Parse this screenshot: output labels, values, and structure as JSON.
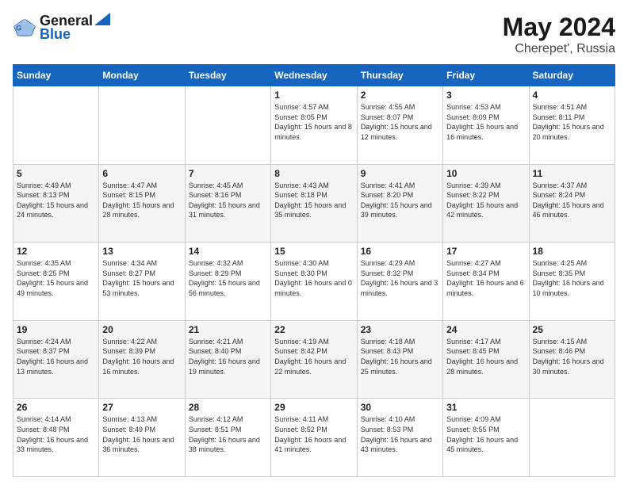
{
  "header": {
    "logo_line1": "General",
    "logo_line2": "Blue",
    "month_year": "May 2024",
    "location": "Cherepet', Russia"
  },
  "days_of_week": [
    "Sunday",
    "Monday",
    "Tuesday",
    "Wednesday",
    "Thursday",
    "Friday",
    "Saturday"
  ],
  "weeks": [
    [
      {
        "day": "",
        "info": ""
      },
      {
        "day": "",
        "info": ""
      },
      {
        "day": "",
        "info": ""
      },
      {
        "day": "1",
        "info": "Sunrise: 4:57 AM\nSunset: 8:05 PM\nDaylight: 15 hours\nand 8 minutes."
      },
      {
        "day": "2",
        "info": "Sunrise: 4:55 AM\nSunset: 8:07 PM\nDaylight: 15 hours\nand 12 minutes."
      },
      {
        "day": "3",
        "info": "Sunrise: 4:53 AM\nSunset: 8:09 PM\nDaylight: 15 hours\nand 16 minutes."
      },
      {
        "day": "4",
        "info": "Sunrise: 4:51 AM\nSunset: 8:11 PM\nDaylight: 15 hours\nand 20 minutes."
      }
    ],
    [
      {
        "day": "5",
        "info": "Sunrise: 4:49 AM\nSunset: 8:13 PM\nDaylight: 15 hours\nand 24 minutes."
      },
      {
        "day": "6",
        "info": "Sunrise: 4:47 AM\nSunset: 8:15 PM\nDaylight: 15 hours\nand 28 minutes."
      },
      {
        "day": "7",
        "info": "Sunrise: 4:45 AM\nSunset: 8:16 PM\nDaylight: 15 hours\nand 31 minutes."
      },
      {
        "day": "8",
        "info": "Sunrise: 4:43 AM\nSunset: 8:18 PM\nDaylight: 15 hours\nand 35 minutes."
      },
      {
        "day": "9",
        "info": "Sunrise: 4:41 AM\nSunset: 8:20 PM\nDaylight: 15 hours\nand 39 minutes."
      },
      {
        "day": "10",
        "info": "Sunrise: 4:39 AM\nSunset: 8:22 PM\nDaylight: 15 hours\nand 42 minutes."
      },
      {
        "day": "11",
        "info": "Sunrise: 4:37 AM\nSunset: 8:24 PM\nDaylight: 15 hours\nand 46 minutes."
      }
    ],
    [
      {
        "day": "12",
        "info": "Sunrise: 4:35 AM\nSunset: 8:25 PM\nDaylight: 15 hours\nand 49 minutes."
      },
      {
        "day": "13",
        "info": "Sunrise: 4:34 AM\nSunset: 8:27 PM\nDaylight: 15 hours\nand 53 minutes."
      },
      {
        "day": "14",
        "info": "Sunrise: 4:32 AM\nSunset: 8:29 PM\nDaylight: 15 hours\nand 56 minutes."
      },
      {
        "day": "15",
        "info": "Sunrise: 4:30 AM\nSunset: 8:30 PM\nDaylight: 16 hours\nand 0 minutes."
      },
      {
        "day": "16",
        "info": "Sunrise: 4:29 AM\nSunset: 8:32 PM\nDaylight: 16 hours\nand 3 minutes."
      },
      {
        "day": "17",
        "info": "Sunrise: 4:27 AM\nSunset: 8:34 PM\nDaylight: 16 hours\nand 6 minutes."
      },
      {
        "day": "18",
        "info": "Sunrise: 4:25 AM\nSunset: 8:35 PM\nDaylight: 16 hours\nand 10 minutes."
      }
    ],
    [
      {
        "day": "19",
        "info": "Sunrise: 4:24 AM\nSunset: 8:37 PM\nDaylight: 16 hours\nand 13 minutes."
      },
      {
        "day": "20",
        "info": "Sunrise: 4:22 AM\nSunset: 8:39 PM\nDaylight: 16 hours\nand 16 minutes."
      },
      {
        "day": "21",
        "info": "Sunrise: 4:21 AM\nSunset: 8:40 PM\nDaylight: 16 hours\nand 19 minutes."
      },
      {
        "day": "22",
        "info": "Sunrise: 4:19 AM\nSunset: 8:42 PM\nDaylight: 16 hours\nand 22 minutes."
      },
      {
        "day": "23",
        "info": "Sunrise: 4:18 AM\nSunset: 8:43 PM\nDaylight: 16 hours\nand 25 minutes."
      },
      {
        "day": "24",
        "info": "Sunrise: 4:17 AM\nSunset: 8:45 PM\nDaylight: 16 hours\nand 28 minutes."
      },
      {
        "day": "25",
        "info": "Sunrise: 4:15 AM\nSunset: 8:46 PM\nDaylight: 16 hours\nand 30 minutes."
      }
    ],
    [
      {
        "day": "26",
        "info": "Sunrise: 4:14 AM\nSunset: 8:48 PM\nDaylight: 16 hours\nand 33 minutes."
      },
      {
        "day": "27",
        "info": "Sunrise: 4:13 AM\nSunset: 8:49 PM\nDaylight: 16 hours\nand 36 minutes."
      },
      {
        "day": "28",
        "info": "Sunrise: 4:12 AM\nSunset: 8:51 PM\nDaylight: 16 hours\nand 38 minutes."
      },
      {
        "day": "29",
        "info": "Sunrise: 4:11 AM\nSunset: 8:52 PM\nDaylight: 16 hours\nand 41 minutes."
      },
      {
        "day": "30",
        "info": "Sunrise: 4:10 AM\nSunset: 8:53 PM\nDaylight: 16 hours\nand 43 minutes."
      },
      {
        "day": "31",
        "info": "Sunrise: 4:09 AM\nSunset: 8:55 PM\nDaylight: 16 hours\nand 45 minutes."
      },
      {
        "day": "",
        "info": ""
      }
    ]
  ]
}
